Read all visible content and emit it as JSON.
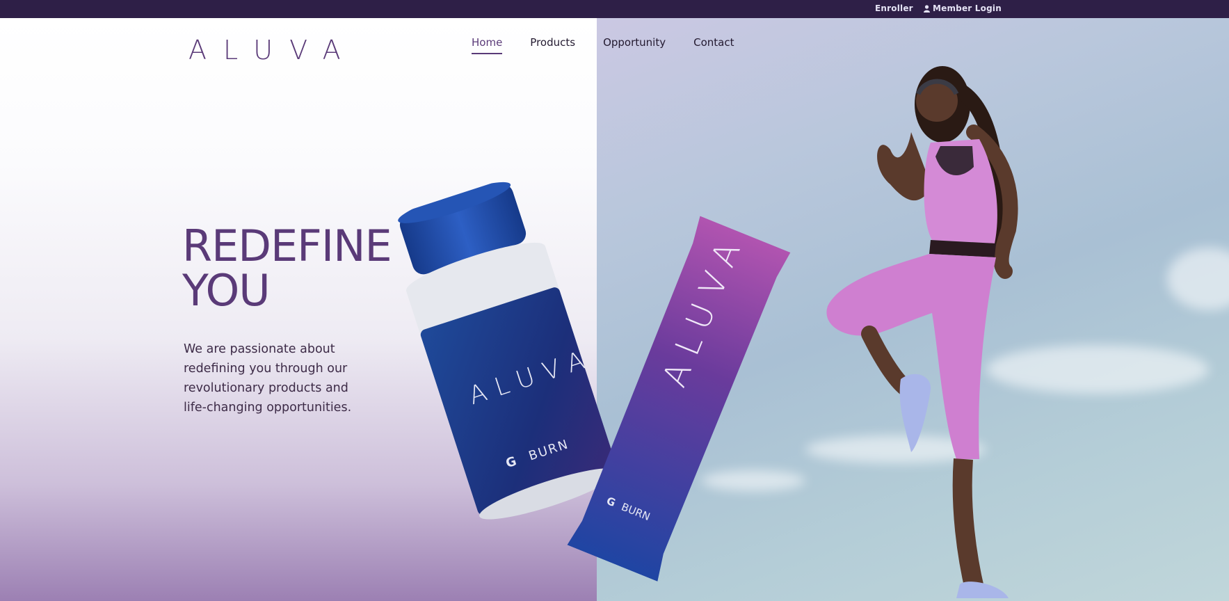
{
  "topbar": {
    "enroller": "Enroller",
    "member_login": "Member Login"
  },
  "brand": {
    "logo": "ALUVA"
  },
  "nav": {
    "home": "Home",
    "products": "Products",
    "opportunity": "Opportunity",
    "contact": "Contact",
    "active": "Home"
  },
  "hero": {
    "headline_line1": "REDEFINE",
    "headline_line2": "YOU",
    "body": "We are passionate about redefining you through our revolutionary products and life-changing opportunities."
  },
  "products": {
    "bottle_brand": "ALUVA",
    "bottle_mark": "G",
    "bottle_product": "BURN",
    "sachet_brand": "ALUVA",
    "sachet_mark": "G",
    "sachet_product": "BURN"
  },
  "colors": {
    "brand_purple": "#5a3a78",
    "topbar_bg": "#2e1f47",
    "bottle_blue": "#1f3f8c",
    "sachet_purple": "#9a4aa4"
  },
  "icons": {
    "user": "user-icon"
  }
}
